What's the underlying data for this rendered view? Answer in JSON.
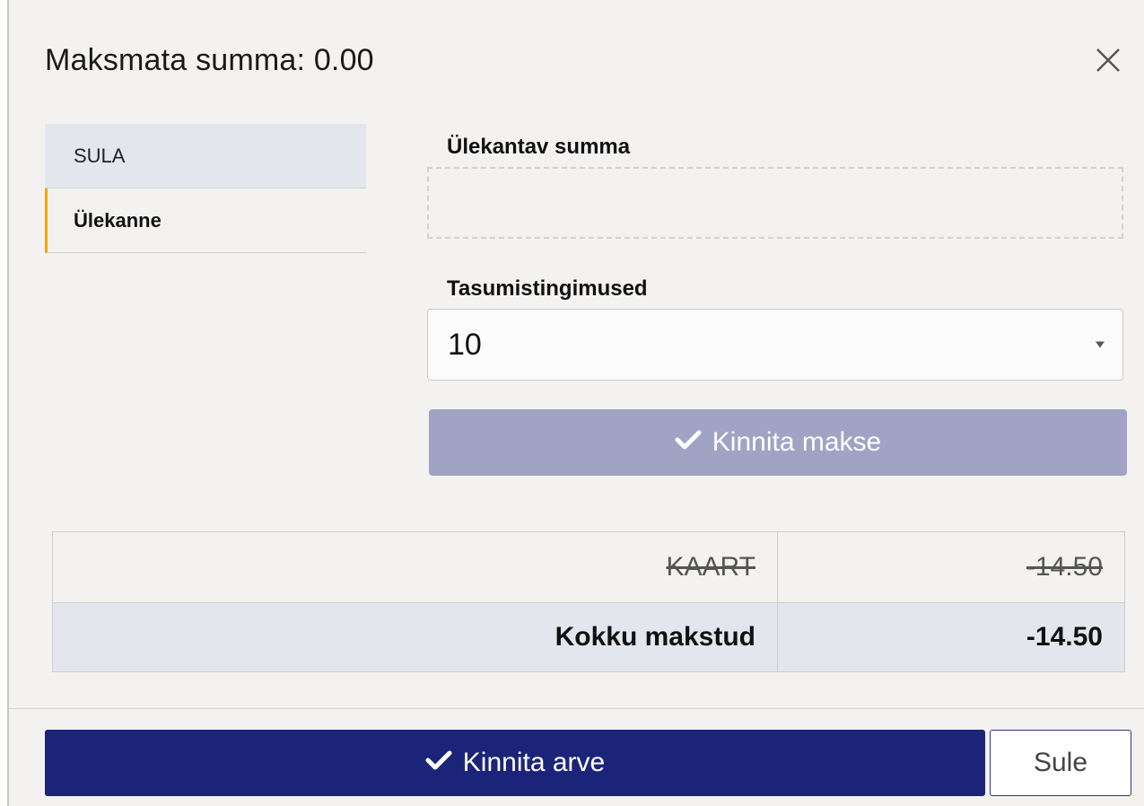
{
  "dialog": {
    "title": "Maksmata summa: 0.00",
    "close_icon": "close-icon"
  },
  "tabs": [
    {
      "label": "SULA",
      "active": false
    },
    {
      "label": "Ülekanne",
      "active": true
    }
  ],
  "form": {
    "amount_label": "Ülekantav summa",
    "amount_value": "",
    "terms_label": "Tasumistingimused",
    "terms_value": "10",
    "confirm_payment_label": "Kinnita makse"
  },
  "payments": {
    "rows": [
      {
        "method": "KAART",
        "amount": "-14.50",
        "cancelled": true
      }
    ],
    "total_label": "Kokku makstud",
    "total_value": "-14.50"
  },
  "footer": {
    "confirm_invoice_label": "Kinnita arve",
    "close_label": "Sule"
  },
  "colors": {
    "primary": "#1c2479",
    "disabled_button": "#a0a3c4",
    "active_tab_accent": "#f0a500",
    "background": "#f3f2f1"
  }
}
